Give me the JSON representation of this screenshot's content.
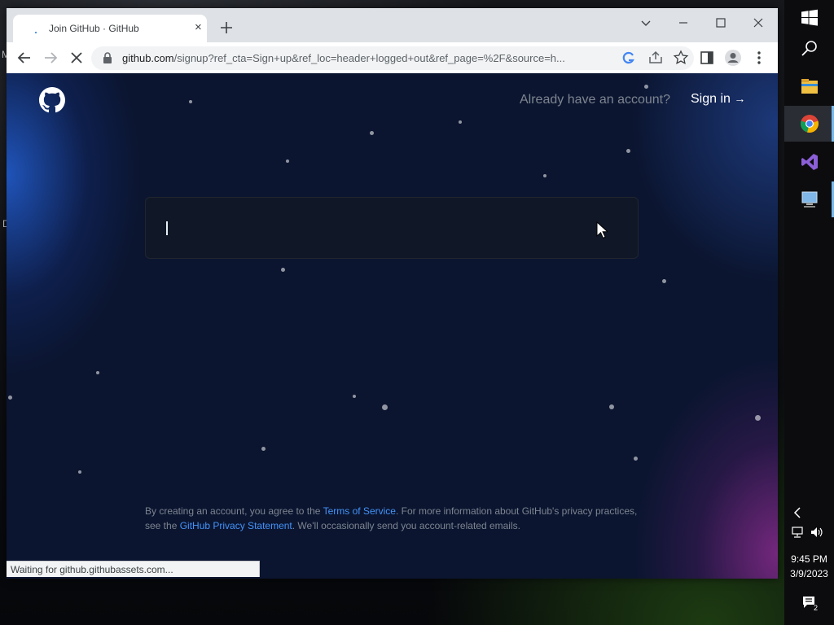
{
  "desktop": {
    "edge_letters": [
      "M",
      "D"
    ]
  },
  "browser": {
    "tab": {
      "title": "Join GitHub · GitHub",
      "close_label": "×"
    },
    "newtab_label": "+",
    "address": {
      "host": "github.com",
      "path": "/signup?ref_cta=Sign+up&ref_loc=header+logged+out&ref_page=%2F&source=h..."
    },
    "status_bubble": "Waiting for github.githubassets.com..."
  },
  "page": {
    "already_text": "Already have an account?",
    "signin_label": "Sign in",
    "signin_arrow": "→",
    "signup_input_value": "",
    "legal": {
      "part1": "By creating an account, you agree to the ",
      "terms_link": "Terms of Service",
      "part2": ". For more information about GitHub's privacy practices, see the ",
      "privacy_link": "GitHub Privacy Statement",
      "part3": ". We'll occasionally send you account-related emails."
    }
  },
  "taskbar": {
    "time": "9:45 PM",
    "date": "3/9/2023",
    "notification_count": "2",
    "apps": [
      "file-explorer-icon",
      "chrome-icon",
      "visual-studio-icon",
      "remote-desktop-icon"
    ]
  },
  "colors": {
    "link": "#4493f8",
    "page_bg": "#0b1530",
    "muted_text": "#7d8590"
  }
}
